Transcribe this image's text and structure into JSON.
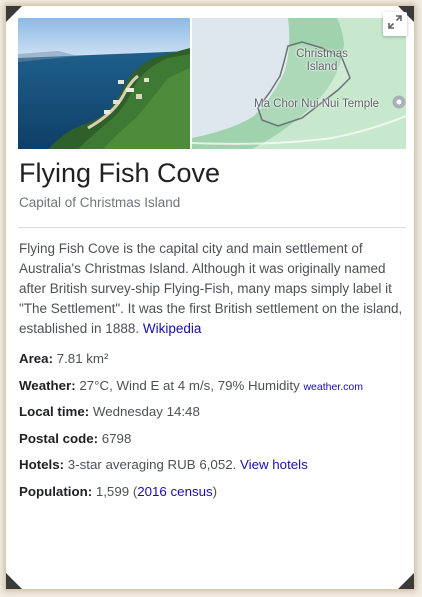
{
  "title": "Flying Fish Cove",
  "subtitle": "Capital of Christmas Island",
  "description": {
    "text": "Flying Fish Cove is the capital city and main settlement of Australia's Christmas Island. Although it was originally named after British survey-ship Flying-Fish, many maps simply label it \"The Settlement\". It was the first British settlement on the island, established in 1888.",
    "source_link": "Wikipedia"
  },
  "map": {
    "label_island_line1": "Christmas",
    "label_island_line2": "Island",
    "label_temple": "Ma Chor Nui Nui Temple"
  },
  "facts": {
    "area": {
      "label": "Area:",
      "value": "7.81 km²"
    },
    "weather": {
      "label": "Weather:",
      "value": "27°C, Wind E at 4 m/s, 79% Humidity",
      "source": "weather.com"
    },
    "local_time": {
      "label": "Local time:",
      "value": "Wednesday 14:48"
    },
    "postal_code": {
      "label": "Postal code:",
      "value": "6798"
    },
    "hotels": {
      "label": "Hotels:",
      "value": "3-star averaging RUB 6,052.",
      "link": "View hotels"
    },
    "population": {
      "label": "Population:",
      "value": "1,599",
      "paren_open": "(",
      "link": "2016 census",
      "paren_close": ")"
    }
  },
  "colors": {
    "title": "#202124",
    "body_text": "#4d5156",
    "link": "#1a0dab",
    "frame_bg": "#f3ece1"
  },
  "icons": [
    "expand-icon",
    "temple-pin-icon"
  ]
}
